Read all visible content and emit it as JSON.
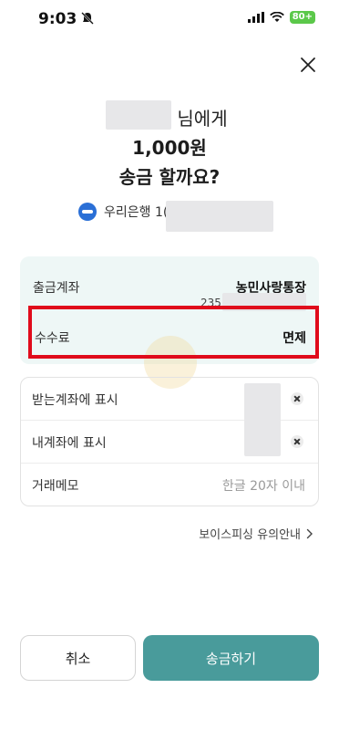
{
  "status_bar": {
    "time": "9:03",
    "battery": "80+",
    "icons": [
      "mute-icon",
      "signal-icon",
      "wifi-icon",
      "battery-icon"
    ]
  },
  "close_icon": "close-icon",
  "header": {
    "recipient_suffix": "님에게",
    "amount": "1,000원",
    "question": "송금 할까요?"
  },
  "bank": {
    "icon": "woori-bank-logo-icon",
    "name_partial": "우리은행 1("
  },
  "transfer_info": {
    "account_label": "출금계좌",
    "account_name": "농민사랑통장",
    "account_number_partial": "235",
    "fee_label": "수수료",
    "fee_value": "면제"
  },
  "memo": {
    "receiver_display_label": "받는계좌에 표시",
    "my_display_label": "내계좌에 표시",
    "memo_label": "거래메모",
    "memo_placeholder": "한글 20자 이내"
  },
  "voice_phishing_link": "보이스피싱 유의안내",
  "buttons": {
    "cancel": "취소",
    "send": "송금하기"
  },
  "colors": {
    "accent": "#499b9b",
    "highlight": "#e00b1b",
    "info_bg": "#eef7f6"
  }
}
